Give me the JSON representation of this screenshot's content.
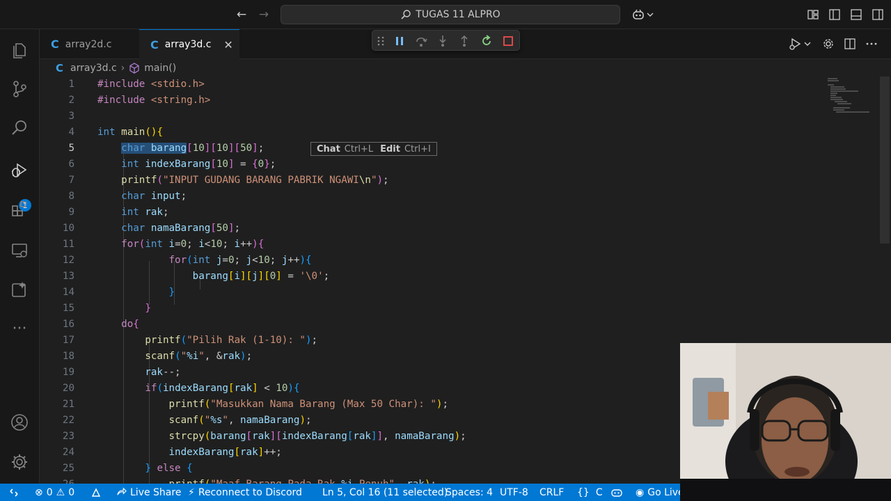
{
  "titlebar": {
    "search_label": "TUGAS 11 ALPRO"
  },
  "tabs": [
    {
      "label": "array2d.c",
      "active": false
    },
    {
      "label": "array3d.c",
      "active": true
    }
  ],
  "tab_close_glyph": "✕",
  "breadcrumb": {
    "file": "array3d.c",
    "symbol": "main()"
  },
  "activity_badge": "1",
  "inline_hint": {
    "chat_label": "Chat",
    "chat_key": "Ctrl+L",
    "edit_label": "Edit",
    "edit_key": "Ctrl+I"
  },
  "editor": {
    "line_numbers": [
      "1",
      "2",
      "3",
      "4",
      "5",
      "6",
      "7",
      "8",
      "9",
      "10",
      "11",
      "12",
      "13",
      "14",
      "15",
      "16",
      "17",
      "18",
      "19",
      "20",
      "21",
      "22",
      "23",
      "24",
      "25",
      "26"
    ],
    "current_line": "5",
    "lines": [
      "#include <stdio.h>",
      "#include <string.h>",
      "",
      "int main(){",
      "    char barang[10][10][50];",
      "    int indexBarang[10] = {0};",
      "    printf(\"INPUT GUDANG BARANG PABRIK NGAWI\\n\");",
      "    char input;",
      "    int rak;",
      "    char namaBarang[50];",
      "    for(int i=0; i<10; i++){",
      "            for(int j=0; j<10; j++){",
      "                barang[i][j][0] = '\\0';",
      "            }",
      "        }",
      "    do{",
      "        printf(\"Pilih Rak (1-10): \");",
      "        scanf(\"%i\", &rak);",
      "        rak--;",
      "        if(indexBarang[rak] < 10){",
      "            printf(\"Masukkan Nama Barang (Max 50 Char): \");",
      "            scanf(\"%s\", namaBarang);",
      "            strcpy(barang[rak][indexBarang[rak]], namaBarang);",
      "            indexBarang[rak]++;",
      "        } else {",
      "            printf(\"Maaf Barang Pada Rak %i Penuh\", rak);"
    ]
  },
  "statusbar": {
    "errors": "0",
    "warnings": "0",
    "live_share": "Live Share",
    "discord": "Reconnect to Discord",
    "cursor": "Ln 5, Col 16 (11 selected)",
    "spaces": "Spaces: 4",
    "encoding": "UTF-8",
    "eol": "CRLF",
    "language": "C",
    "go_live": "Go Live"
  },
  "colors": {
    "accent": "#0078d4",
    "editor_bg": "#1f1f1f",
    "keyword": "#569cd6",
    "string": "#ce9178",
    "function": "#dcdcaa",
    "number": "#b5cea8",
    "variable": "#9cdcfe",
    "control": "#c586c0"
  }
}
